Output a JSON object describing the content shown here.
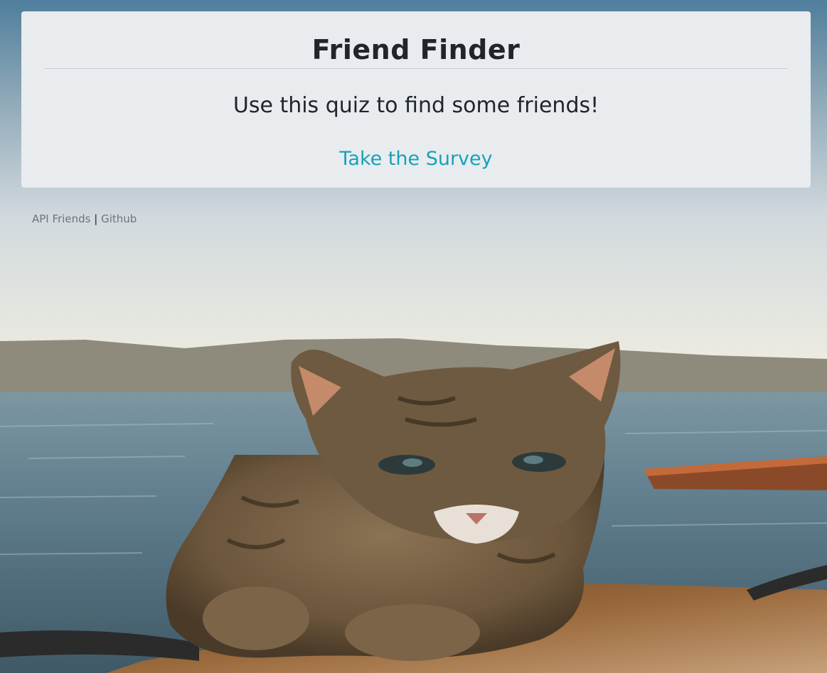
{
  "hero": {
    "title": "Friend Finder",
    "subtitle": "Use this quiz to find some friends!",
    "survey_link": "Take the Survey"
  },
  "footer": {
    "api_link": "API Friends",
    "separator": "|",
    "github_link": "Github"
  },
  "background": {
    "subject": "tabby cat on a dock by the sea",
    "colors": {
      "sky_top": "#4f7e9c",
      "sky_mid": "#cfd8dc",
      "horizon": "#f0ece0",
      "water": "#5f7d8c",
      "cat": "#7a6245",
      "wood": "#8a5a30"
    }
  },
  "colors": {
    "panel": "#e9ecef",
    "text": "#212529",
    "link": "#17a2b8",
    "muted": "#6c757d"
  }
}
